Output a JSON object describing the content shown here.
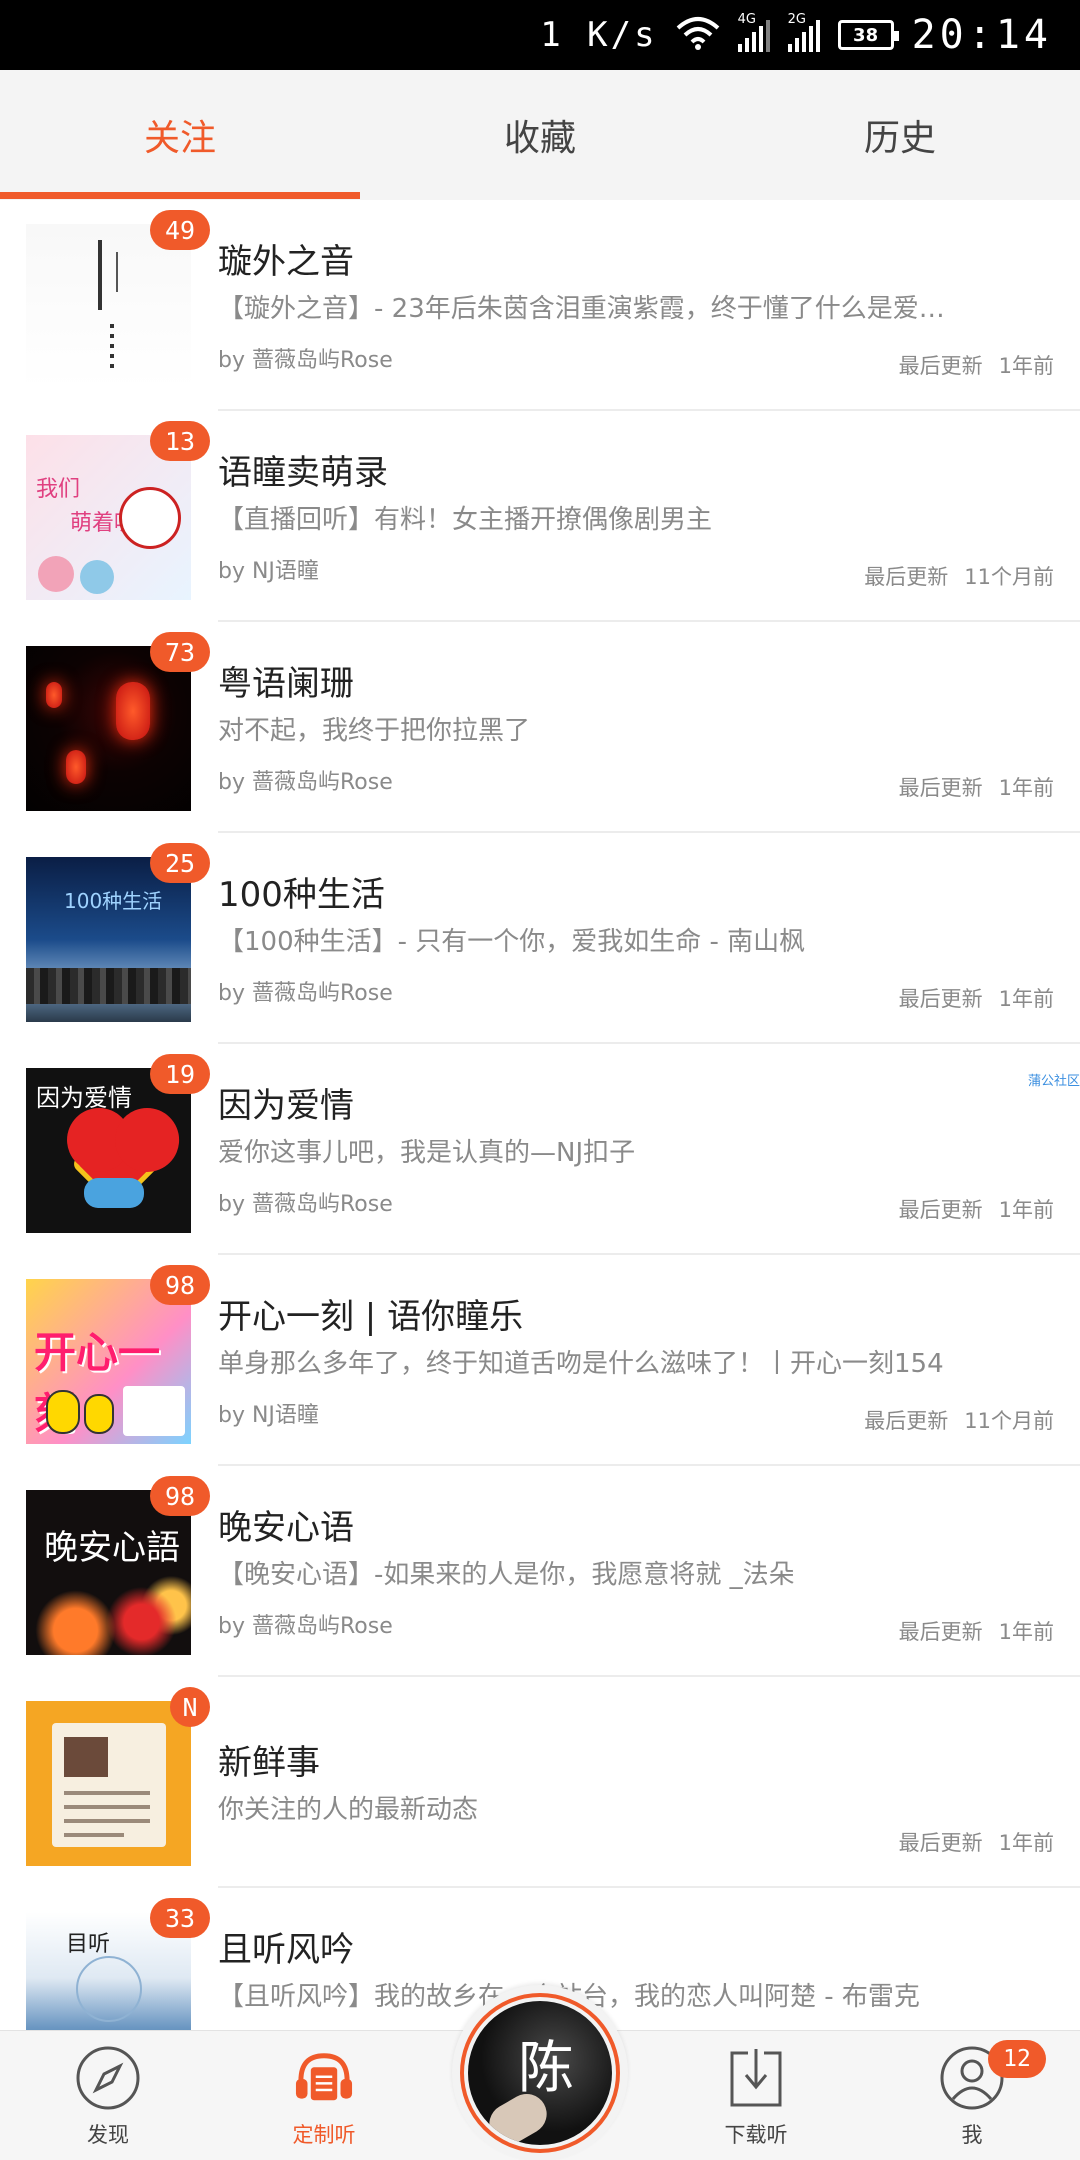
{
  "status_bar": {
    "speed": "1 K/s",
    "net1_label": "4G",
    "net2_label": "2G",
    "battery": "38",
    "time": "20:14"
  },
  "tabs": [
    {
      "label": "关注",
      "active": true
    },
    {
      "label": "收藏",
      "active": false
    },
    {
      "label": "历史",
      "active": false
    }
  ],
  "accent_color": "#f05a2a",
  "feed": [
    {
      "badge": "49",
      "title": "璇外之音",
      "subtitle": "【璇外之音】- 23年后朱茵含泪重演紫霞，终于懂了什么是爱…",
      "author": "by 蔷薇岛屿Rose",
      "updated_label": "最后更新",
      "updated_time": "1年前"
    },
    {
      "badge": "13",
      "title": "语瞳卖萌录",
      "subtitle": "【直播回听】有料！女主播开撩偶像剧男主",
      "author": "by NJ语瞳",
      "updated_label": "最后更新",
      "updated_time": "11个月前"
    },
    {
      "badge": "73",
      "title": "粤语阑珊",
      "subtitle": "对不起，我终于把你拉黑了",
      "author": "by 蔷薇岛屿Rose",
      "updated_label": "最后更新",
      "updated_time": "1年前"
    },
    {
      "badge": "25",
      "title": "100种生活",
      "subtitle": "【100种生活】- 只有一个你，爱我如生命 - 南山枫",
      "author": "by 蔷薇岛屿Rose",
      "updated_label": "最后更新",
      "updated_time": "1年前"
    },
    {
      "badge": "19",
      "title": "因为爱情",
      "subtitle": "爱你这事儿吧，我是认真的—NJ扣子",
      "author": "by 蔷薇岛屿Rose",
      "updated_label": "最后更新",
      "updated_time": "1年前",
      "sidetag": "蒲公社区"
    },
    {
      "badge": "98",
      "title": "开心一刻 | 语你瞳乐",
      "subtitle": "单身那么多年了，终于知道舌吻是什么滋味了！丨开心一刻154",
      "author": "by NJ语瞳",
      "updated_label": "最后更新",
      "updated_time": "11个月前"
    },
    {
      "badge": "98",
      "title": "晚安心语",
      "subtitle": "【晚安心语】-如果来的人是你，我愿意将就 _法朵",
      "author": "by 蔷薇岛屿Rose",
      "updated_label": "最后更新",
      "updated_time": "1年前"
    },
    {
      "badge": "N",
      "title": "新鲜事",
      "subtitle": "你关注的人的最新动态",
      "author": "",
      "updated_label": "最后更新",
      "updated_time": "1年前"
    },
    {
      "badge": "33",
      "title": "且听风吟",
      "subtitle": "【且听风吟】我的故乡在一个站台，我的恋人叫阿楚 - 布雷克",
      "author": "",
      "updated_label": "",
      "updated_time": ""
    }
  ],
  "thumbs": {
    "t1": "璇外之音",
    "t2a": "我们",
    "t2b": "萌着呢!",
    "t4": "100种生活",
    "t5": "因为爱情",
    "t6": "开心一刻",
    "t7": "晚安心語",
    "t9": "目听"
  },
  "bottom_nav": {
    "discover": "发现",
    "custom": "定制听",
    "download": "下载听",
    "me": "我",
    "me_badge": "12"
  },
  "player": {
    "glyph": "陈"
  }
}
